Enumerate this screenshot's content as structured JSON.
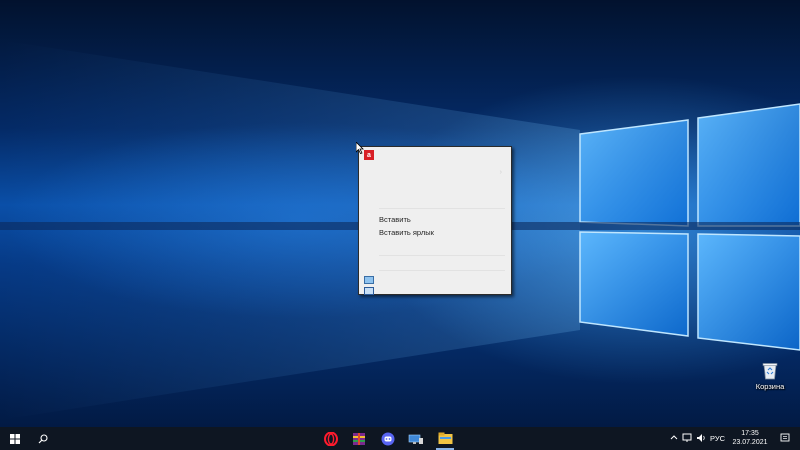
{
  "context_menu": {
    "header": "",
    "items": [
      {
        "label": "",
        "state": "faint"
      },
      {
        "label": "",
        "state": "faint"
      },
      {
        "label": "",
        "state": "faint"
      },
      {
        "label": "Вставить",
        "state": "normal"
      },
      {
        "label": "Вставить ярлык",
        "state": "normal"
      },
      {
        "label": "",
        "state": "faint"
      },
      {
        "label": "",
        "state": "faint"
      },
      {
        "label": "",
        "state": "faint"
      },
      {
        "label": "",
        "state": "faint"
      }
    ]
  },
  "desktop_icons": {
    "recycle_bin": "Корзина"
  },
  "taskbar": {
    "language": "РУС",
    "time": "17:35",
    "date": "23.07.2021",
    "apps": [
      "opera-icon",
      "winrar-icon",
      "discord-icon",
      "desktop-pc-icon",
      "file-explorer-icon"
    ]
  },
  "colors": {
    "accent_amd": "#d81f26",
    "taskbar_bg": "#0e1622"
  }
}
